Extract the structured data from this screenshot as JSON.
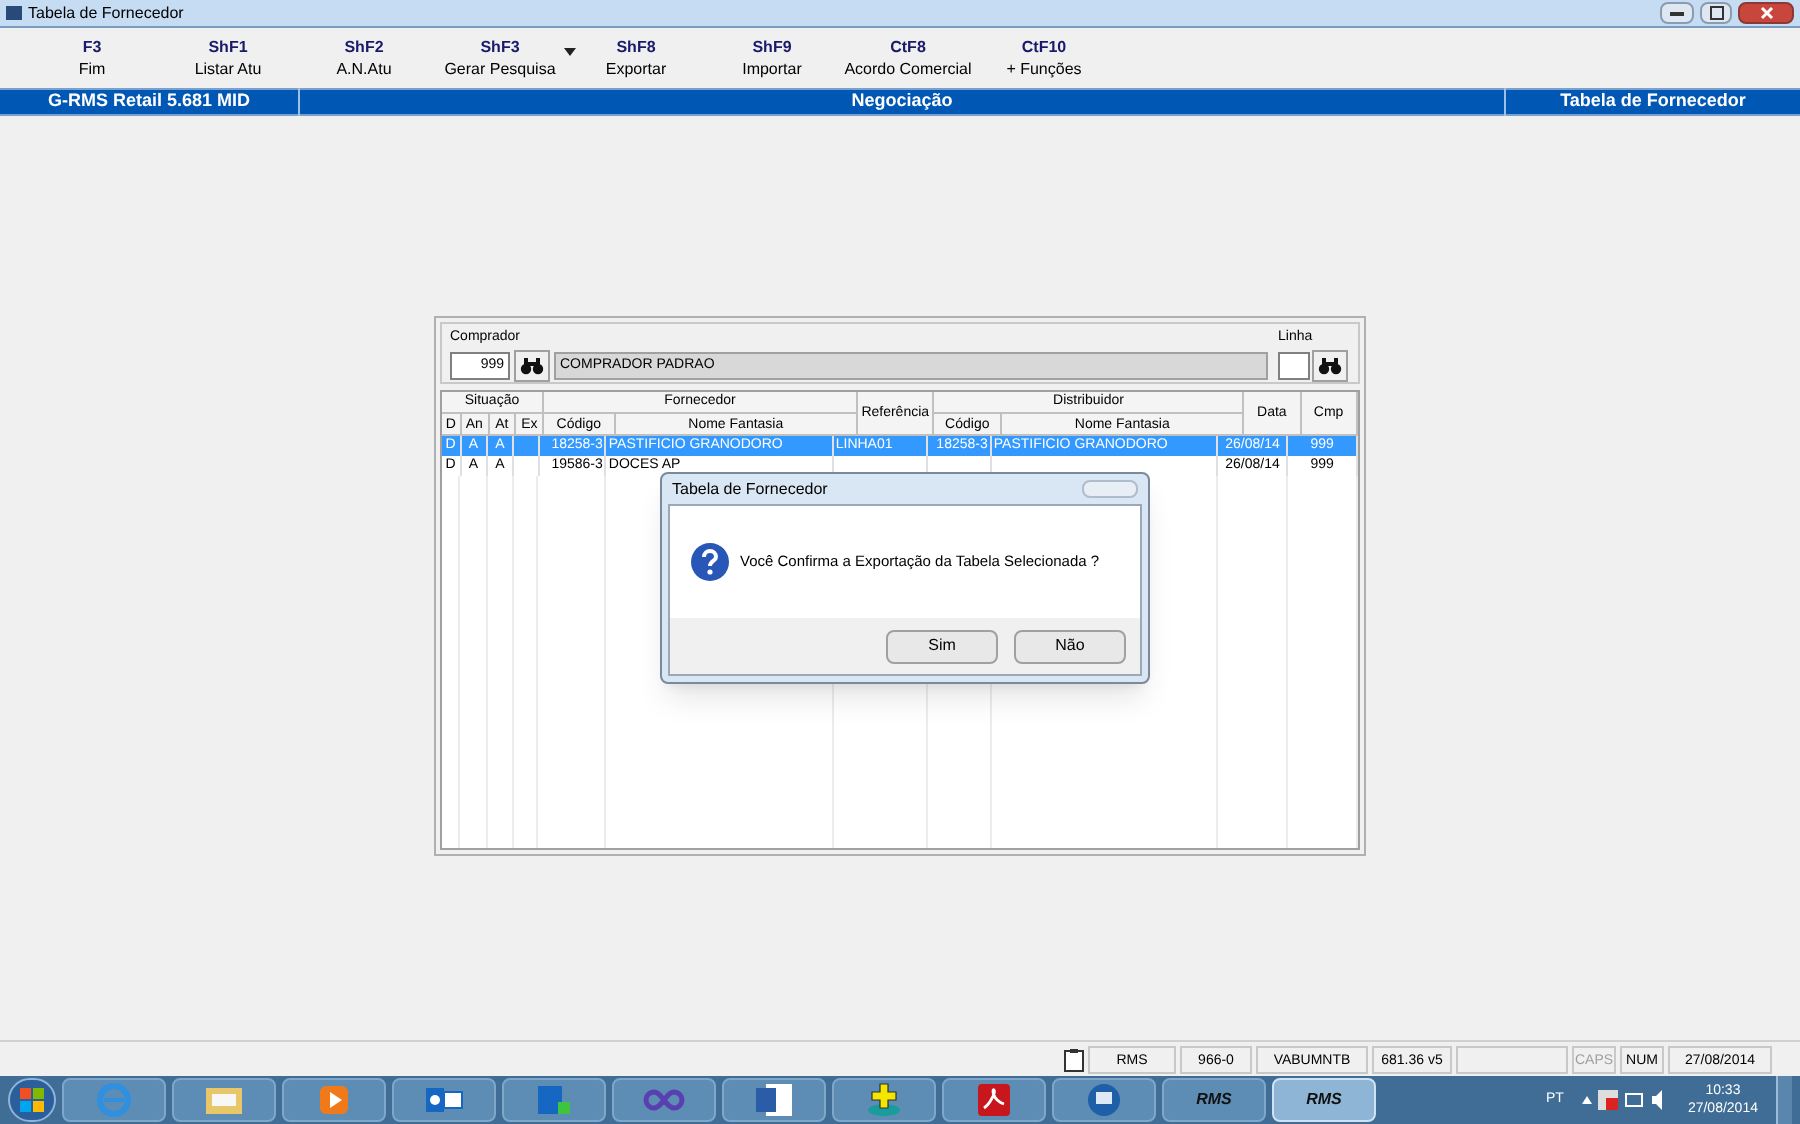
{
  "window": {
    "title": "Tabela de Fornecedor"
  },
  "toolbar": [
    {
      "key": "F3",
      "label": "Fim",
      "dropdown": false
    },
    {
      "key": "ShF1",
      "label": "Listar Atu",
      "dropdown": false
    },
    {
      "key": "ShF2",
      "label": "A.N.Atu",
      "dropdown": false
    },
    {
      "key": "ShF3",
      "label": "Gerar Pesquisa",
      "dropdown": true
    },
    {
      "key": "ShF8",
      "label": "Exportar",
      "dropdown": false
    },
    {
      "key": "ShF9",
      "label": "Importar",
      "dropdown": false
    },
    {
      "key": "CtF8",
      "label": "Acordo Comercial",
      "dropdown": false
    },
    {
      "key": "CtF10",
      "label": "+ Funções",
      "dropdown": false
    }
  ],
  "header_bar": {
    "app": "G-RMS Retail 5.681 MID",
    "module": "Negociação",
    "screen": "Tabela de Fornecedor"
  },
  "comprador": {
    "label": "Comprador",
    "code": "999",
    "name": "COMPRADOR PADRAO"
  },
  "linha": {
    "label": "Linha"
  },
  "table": {
    "groups": [
      {
        "label": "Situação",
        "columns": [
          "D",
          "An",
          "At",
          "Ex"
        ]
      },
      {
        "label": "Fornecedor",
        "columns": [
          "Código",
          "Nome Fantasia"
        ]
      },
      {
        "label": "Referência"
      },
      {
        "label": "Distribuidor",
        "columns": [
          "Código",
          "Nome Fantasia"
        ]
      },
      {
        "label": "Data"
      },
      {
        "label": "Cmp"
      }
    ],
    "rows": [
      {
        "selected": true,
        "cells": [
          "D",
          "A",
          "A",
          "",
          "18258-3",
          "PASTIFICIO GRANODORO",
          "LINHA01",
          "18258-3",
          "PASTIFICIO GRANODORO",
          "26/08/14",
          "999"
        ]
      },
      {
        "selected": false,
        "cells": [
          "D",
          "A",
          "A",
          "",
          "19586-3",
          "DOCES AP",
          "",
          "",
          "",
          "26/08/14",
          "999"
        ]
      }
    ]
  },
  "dialog": {
    "title": "Tabela de Fornecedor",
    "message": "Você Confirma a Exportação da Tabela Selecionada ?",
    "buttons": [
      "Sim",
      "Não"
    ]
  },
  "status_bar": [
    {
      "kind": "text",
      "text": "RMS",
      "disabled": false
    },
    {
      "kind": "text",
      "text": "966-0",
      "disabled": false
    },
    {
      "kind": "text",
      "text": "VABUMNTB",
      "disabled": false
    },
    {
      "kind": "text",
      "text": "681.36 v5",
      "disabled": false
    },
    {
      "kind": "blank"
    },
    {
      "kind": "text",
      "text": "CAPS",
      "disabled": true
    },
    {
      "kind": "text",
      "text": "NUM",
      "disabled": false
    },
    {
      "kind": "text",
      "text": "27/08/2014",
      "disabled": false
    }
  ],
  "taskbar": {
    "apps": [
      {
        "kind": "ie"
      },
      {
        "kind": "folder"
      },
      {
        "kind": "media"
      },
      {
        "kind": "outlook"
      },
      {
        "kind": "lync"
      },
      {
        "kind": "infinity"
      },
      {
        "kind": "word"
      },
      {
        "kind": "stack"
      },
      {
        "kind": "pdf"
      },
      {
        "kind": "remote"
      },
      {
        "kind": "rms",
        "label": "RMS",
        "active": false
      },
      {
        "kind": "rms",
        "label": "RMS",
        "active": true
      }
    ],
    "language": "PT",
    "time": "10:33",
    "date": "27/08/2014"
  }
}
